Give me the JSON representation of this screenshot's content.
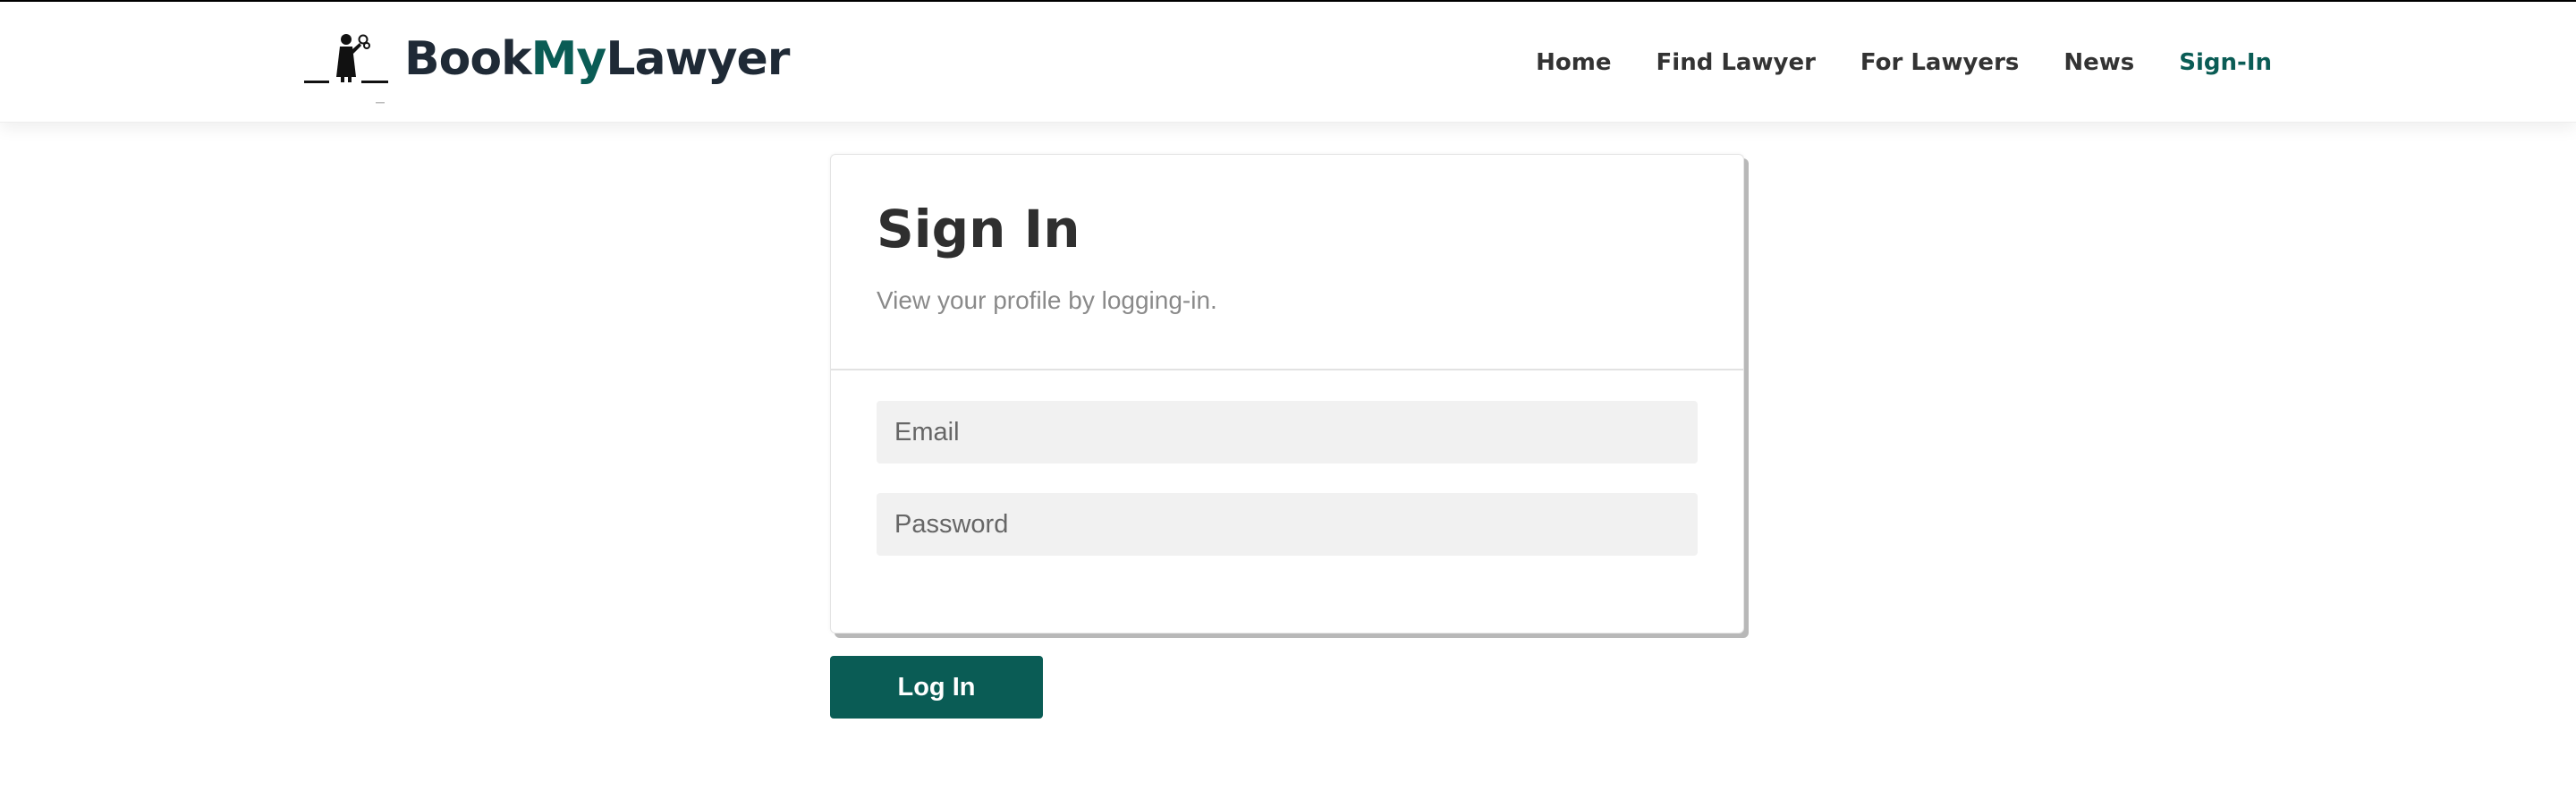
{
  "header": {
    "brand": {
      "name_part1": "Book",
      "name_part2": "My",
      "name_part3": "Lawyer",
      "accent_color": "#0a5c55",
      "text_color": "#1f2a36",
      "icon": "lawyer-with-scales-icon"
    },
    "nav": [
      {
        "label": "Home",
        "active": false
      },
      {
        "label": "Find Lawyer",
        "active": false
      },
      {
        "label": "For Lawyers",
        "active": false
      },
      {
        "label": "News",
        "active": false
      },
      {
        "label": "Sign-In",
        "active": true
      }
    ]
  },
  "signin": {
    "title": "Sign In",
    "subtitle": "View your profile by logging-in.",
    "email_placeholder": "Email",
    "password_placeholder": "Password",
    "email_value": "",
    "password_value": "",
    "submit_label": "Log In",
    "button_color": "#0a5c55"
  }
}
